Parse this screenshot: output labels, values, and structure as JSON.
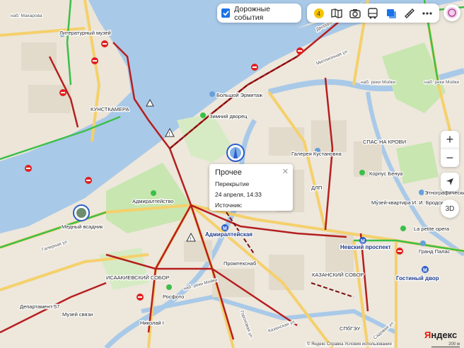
{
  "layer_toggle": {
    "label": "Дорожные события",
    "checked": true
  },
  "toolbar": {
    "badge": "4",
    "icons": [
      "traffic-light-icon",
      "book-map-icon",
      "camera-icon",
      "bus-icon",
      "layers-icon",
      "ruler-icon",
      "more-icon"
    ]
  },
  "map_controls": {
    "zoom_in": "+",
    "zoom_out": "−",
    "view_3d": "3D"
  },
  "popup": {
    "title": "Прочее",
    "type": "Перекрытие",
    "date": "24 апреля, 14:33",
    "source": "Источник:"
  },
  "labels": {
    "makarova": "наб. Макарова",
    "literary_museum": "Литературный музей",
    "kunstkamera": "КУНСТКАМЕРА",
    "dvortsovaya": "Дворцовая",
    "big_hermitage": "Большой Эрмитаж",
    "winter_palace": "Зимний дворец",
    "moika_1": "наб. реки Мойки",
    "moika_2": "наб. реки Мойки",
    "millionnaya": "Миллионная ул.",
    "spas": "СПАС НА КРОВИ",
    "gallery": "Галерея Кустановна",
    "dlp": "ДЛП",
    "korpus_benua": "Корпус Бенуа",
    "ethnographic": "Этнографический м",
    "brodsky": "Музей-квартира И. И. Бродского",
    "admiralty": "Адмиралтейство",
    "bronze_horseman": "Медный всадник",
    "admiralteyskaya": "Адмиралтейская",
    "nevsky": "Невский проспект",
    "la_petite": "La petite opera",
    "grand_palace": "Гранд Палас",
    "promtekhsnab": "Промтехснаб",
    "galernaya": "Галерная ул.",
    "isaakievsky": "ИСААКИЕВСКИЙ СОБОР",
    "kazansky": "КАЗАНСКИЙ СОБОР",
    "gostiny": "Гостиный двор",
    "department57": "Департамент 57",
    "museum_communication": "Музей связи",
    "rosfoto": "Росфото",
    "nikolai": "Николай I",
    "spbgeu": "СПбГЭУ",
    "gorokhovaya": "Гороховая ул.",
    "kazanskaya": "Казанская ул.",
    "sadovaya": "Садовая ул.",
    "moika_3": "наб. реки Мойки"
  },
  "footer": {
    "copyright": "© Яндекс   Справка   Условия использования",
    "scale": "200 м"
  },
  "logo": {
    "ya": "Я",
    "rest": "ндекс"
  },
  "colors": {
    "water": "#a9c9e8",
    "land": "#ede7dc",
    "park": "#c8e6b0",
    "traffic_green": "#3bbf4a",
    "traffic_red": "#b51f1f",
    "traffic_yellow": "#f5b400",
    "road_yellow": "#f5d06b",
    "closure_red": "#e02020",
    "metro": "#2d5ec9"
  }
}
